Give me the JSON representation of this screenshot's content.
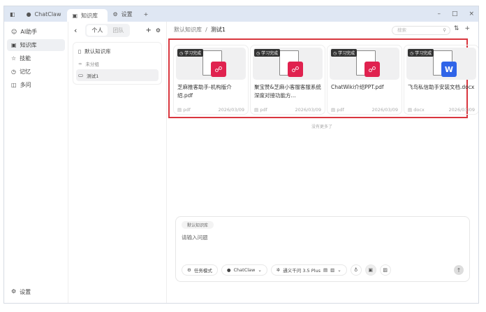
{
  "titlebar": {
    "app_name": "ChatClaw",
    "tabs": [
      {
        "label": "知识库",
        "active": true
      },
      {
        "label": "设置",
        "active": false
      }
    ],
    "new_tab": "+",
    "controls": [
      "–",
      "□",
      "×"
    ]
  },
  "sidebar": {
    "items": [
      {
        "label": "AI助手",
        "icon": "robot-icon"
      },
      {
        "label": "知识库",
        "icon": "book-icon",
        "active": true
      },
      {
        "label": "技能",
        "icon": "star-icon"
      },
      {
        "label": "记忆",
        "icon": "clock-icon"
      },
      {
        "label": "多问",
        "icon": "split-icon"
      }
    ],
    "settings": "设置"
  },
  "panel": {
    "back": "‹",
    "seg": [
      "个人",
      "团队"
    ],
    "add": "+",
    "gear": "⚙",
    "default_kb": "默认知识库",
    "ungrouped": "未分组",
    "folders": [
      "测试1"
    ]
  },
  "main": {
    "breadcrumb": [
      "默认知识库",
      "测试1"
    ],
    "search_placeholder": "搜索",
    "files": [
      {
        "badge": "学习完成",
        "name": "芝麻推客助手-机构版介绍.pdf",
        "type": "pdf",
        "date": "2026/03/09",
        "color": "#e0224f"
      },
      {
        "badge": "学习完成",
        "name": "聚宝赞&芝麻小客服客服系统深度对接功能方...",
        "type": "pdf",
        "date": "2026/03/09",
        "color": "#e0224f"
      },
      {
        "badge": "学习完成",
        "name": "ChatWiki介绍PPT.pdf",
        "type": "pdf",
        "date": "2026/03/09",
        "color": "#e0224f"
      },
      {
        "badge": "学习完成",
        "name": "飞鸟私信助手安装文档.docx",
        "type": "docx",
        "date": "2026/03/09",
        "color": "#2f64e8"
      }
    ],
    "no_more": "没有更多了"
  },
  "composer": {
    "kb_tag": "默认知识库",
    "placeholder": "请输入问题",
    "task_mode": "任务模式",
    "agent": "ChatClaw",
    "model": "通义千问 3.5 Plus"
  }
}
